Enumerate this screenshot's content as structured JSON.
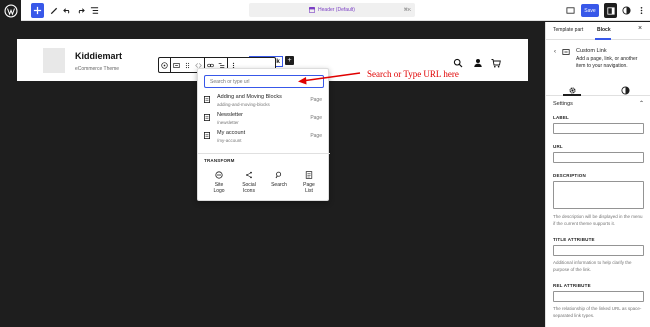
{
  "topbar": {
    "wp_logo_icon": "wordpress-icon",
    "document_title": "Header (Default)",
    "shortcut": "⌘K",
    "save_label": "Save"
  },
  "canvas": {
    "site_title": "Kiddiemart",
    "tagline": "eCommerce Theme",
    "add_link_label": "Add Link",
    "icons": [
      "search-icon",
      "account-icon",
      "cart-icon"
    ]
  },
  "link_popover": {
    "search_placeholder": "Search or type url",
    "results": [
      {
        "title": "Adding and Moving Blocks",
        "url": "adding-and-moving-blocks",
        "type": "Page"
      },
      {
        "title": "Newsletter",
        "url": "/newsletter",
        "type": "Page"
      },
      {
        "title": "My account",
        "url": "/my-account",
        "type": "Page"
      }
    ],
    "transform_label": "TRANSFORM",
    "transforms": [
      {
        "label": "Site\nLogo",
        "icon": "site-logo-icon"
      },
      {
        "label": "Social\nIcons",
        "icon": "share-icon"
      },
      {
        "label": "Search",
        "icon": "search-icon"
      },
      {
        "label": "Page\nList",
        "icon": "page-list-icon"
      }
    ]
  },
  "annotation": {
    "text": "Search or Type URL here",
    "color": "#e00000"
  },
  "sidebar": {
    "tabs": [
      "Template part",
      "Block"
    ],
    "active_tab": "Block",
    "block_name": "Custom Link",
    "block_description": "Add a page, link, or another item to your navigation.",
    "settings_heading": "Settings",
    "fields": [
      {
        "label": "LABEL",
        "value": ""
      },
      {
        "label": "URL",
        "value": ""
      },
      {
        "label": "DESCRIPTION",
        "value": "",
        "help": "The description will be displayed in the menu if the current theme supports it."
      },
      {
        "label": "TITLE ATTRIBUTE",
        "value": "",
        "help": "Additional information to help clarify the purpose of the link."
      },
      {
        "label": "REL ATTRIBUTE",
        "value": "",
        "help": "The relationship of the linked URL as space-separated link types."
      }
    ]
  },
  "colors": {
    "accent": "#3858e9",
    "editor_bg": "#1e1e1e"
  }
}
